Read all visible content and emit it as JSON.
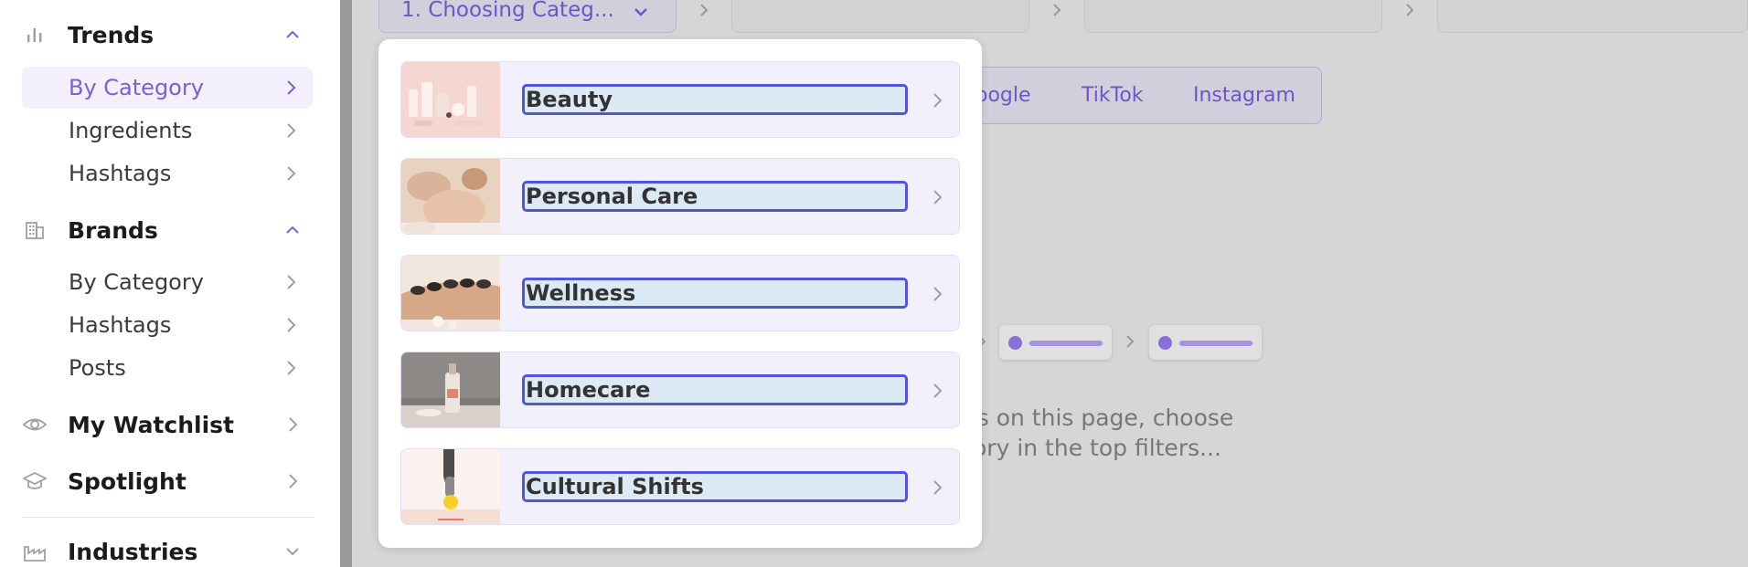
{
  "sidebar": {
    "sections": [
      {
        "label": "Trends",
        "icon": "bar-chart-icon",
        "expanded": true
      },
      {
        "label": "Brands",
        "icon": "building-icon",
        "expanded": true
      },
      {
        "label": "My Watchlist",
        "icon": "eye-icon"
      },
      {
        "label": "Spotlight",
        "icon": "mortarboard-icon"
      },
      {
        "label": "Industries",
        "icon": "factory-icon",
        "expanded": false
      }
    ],
    "trends_items": [
      {
        "label": "By Category",
        "active": true
      },
      {
        "label": "Ingredients"
      },
      {
        "label": "Hashtags"
      }
    ],
    "brands_items": [
      {
        "label": "By Category"
      },
      {
        "label": "Hashtags"
      },
      {
        "label": "Posts"
      }
    ]
  },
  "filter_bar": {
    "step_select": "1. Choosing Categ..."
  },
  "platform_tabs": [
    "oogle",
    "TikTok",
    "Instagram"
  ],
  "empty_state": {
    "line1": "lts on this page, choose",
    "line2": "ory in the top filters..."
  },
  "category_popup": {
    "items": [
      {
        "label": "Beauty",
        "thumb": "beauty-products-image"
      },
      {
        "label": "Personal Care",
        "thumb": "massage-image"
      },
      {
        "label": "Wellness",
        "thumb": "hot-stone-image"
      },
      {
        "label": "Homecare",
        "thumb": "diffuser-image"
      },
      {
        "label": "Cultural Shifts",
        "thumb": "hand-holding-lemon-image"
      }
    ]
  },
  "colors": {
    "accent": "#7a61d6",
    "highlight_border": "#5055da",
    "highlight_fill": "#dbeaf4",
    "item_bg": "#f3f0fe",
    "overlay": "#d6d6d6"
  }
}
